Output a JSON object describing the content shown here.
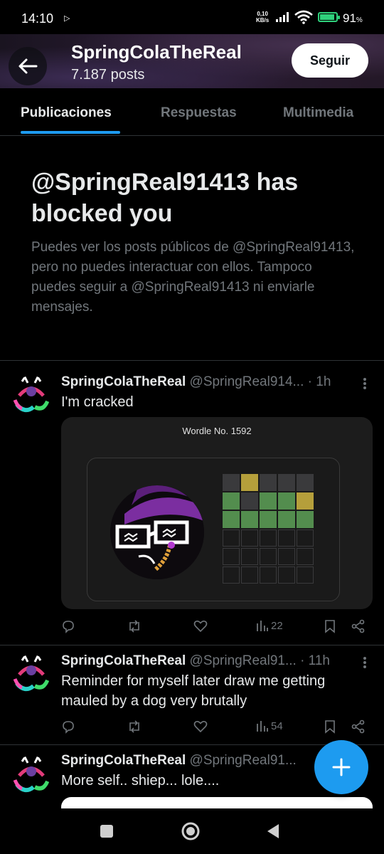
{
  "status_bar": {
    "time": "14:10",
    "net_speed_value": "0,10",
    "net_speed_unit": "KB/s",
    "battery_pct": "91",
    "battery_unit": "%",
    "battery_level": 0.91
  },
  "header": {
    "name": "SpringColaTheReal",
    "posts": "7.187 posts",
    "follow_label": "Seguir"
  },
  "tabs": [
    {
      "label": "Publicaciones",
      "active": true
    },
    {
      "label": "Respuestas",
      "active": false
    },
    {
      "label": "Multimedia",
      "active": false
    }
  ],
  "blocked": {
    "title": "@SpringReal91413 has blocked you",
    "description": "Puedes ver los posts públicos de @SpringReal91413, pero no puedes interactuar con ellos. Tampoco puedes seguir a @SpringReal91413 ni enviarle mensajes."
  },
  "posts": [
    {
      "name": "SpringColaTheReal",
      "handle": "@SpringReal914...",
      "time": "· 1h",
      "text": "I'm cracked",
      "views": "22",
      "wordle": {
        "title": "Wordle No. 1592",
        "rows": [
          [
            "absent",
            "present",
            "absent",
            "absent",
            "absent"
          ],
          [
            "correct",
            "absent",
            "correct",
            "correct",
            "present"
          ],
          [
            "correct",
            "correct",
            "correct",
            "correct",
            "correct"
          ],
          [
            "empty",
            "empty",
            "empty",
            "empty",
            "empty"
          ],
          [
            "empty",
            "empty",
            "empty",
            "empty",
            "empty"
          ],
          [
            "empty",
            "empty",
            "empty",
            "empty",
            "empty"
          ]
        ]
      }
    },
    {
      "name": "SpringColaTheReal",
      "handle": "@SpringReal91...",
      "time": "· 11h",
      "text": "Reminder for myself later draw me getting mauled by a dog very brutally",
      "views": "54"
    },
    {
      "name": "SpringColaTheReal",
      "handle": "@SpringReal91...",
      "time": "",
      "text": "More self.. shiep... lole...."
    }
  ],
  "colors": {
    "accent": "#1d9bf0",
    "correct": "#538d4e",
    "present": "#b59f3b",
    "absent": "#3a3a3c",
    "empty_border": "#3a3a3c"
  }
}
